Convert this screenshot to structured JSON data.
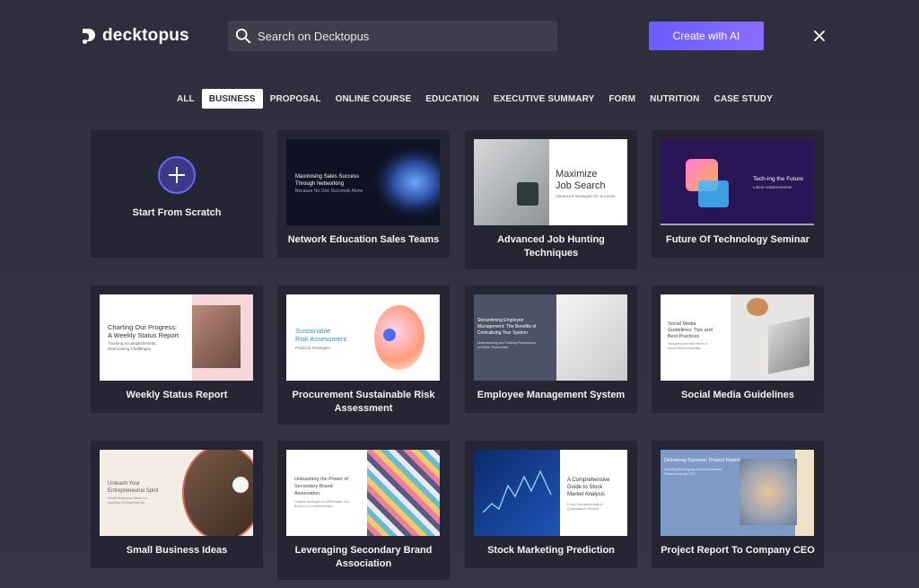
{
  "header": {
    "logo_text": "decktopus",
    "search_placeholder": "Search on Decktopus",
    "ai_button": "Create with AI"
  },
  "tabs": [
    "ALL",
    "BUSINESS",
    "PROPOSAL",
    "ONLINE COURSE",
    "EDUCATION",
    "EXECUTIVE SUMMARY",
    "FORM",
    "NUTRITION",
    "CASE STUDY"
  ],
  "active_tab": "BUSINESS",
  "cards": [
    {
      "title": "Start From Scratch"
    },
    {
      "title": "Network Education Sales Teams",
      "thumb_lines": [
        "Maximising Sales Success",
        "Through Networking",
        "Because No One Succeeds Alone"
      ]
    },
    {
      "title": "Advanced Job Hunting Techniques",
      "thumb_lines": [
        "Maximize",
        "Job Search",
        "Advanced Strategies for Success"
      ]
    },
    {
      "title": "Future Of Technology Seminar",
      "thumb_lines": [
        "Tech-ing the Future",
        "Latest Advancements"
      ]
    },
    {
      "title": "Weekly Status Report",
      "thumb_lines": [
        "Charting Our Progress:",
        "A Weekly Status Report",
        "Tracking Accomplishments,",
        "Overcoming Challenges"
      ]
    },
    {
      "title": "Procurement Sustainable Risk Assessment",
      "thumb_lines": [
        "Sustainable",
        "Risk Assessment",
        "Practical Strategies"
      ]
    },
    {
      "title": "Employee Management System",
      "thumb_lines": [
        "Streamlining Employee",
        "Management: The Benefits of",
        "Centralizing Your System",
        "Understanding and Tracking Performance",
        "for Better Team Action"
      ]
    },
    {
      "title": "Social Media Guidelines",
      "thumb_lines": [
        "Social Media",
        "Guidelines: Tips and",
        "Best Practices",
        "Navigating the Wild World of",
        "Social Media Marketing"
      ]
    },
    {
      "title": "Small Business Ideas",
      "thumb_lines": [
        "Unleash Your",
        "Entrepreneurial Spirit",
        "Small Business Ideas for",
        "Aspiring Entrepreneurs"
      ]
    },
    {
      "title": "Leveraging Secondary Brand Association",
      "thumb_lines": [
        "Unleashing the Power of",
        "Secondary Brand",
        "Association",
        "Creative Strategies to Differentiate Your",
        "Brand in a Crowded Market"
      ]
    },
    {
      "title": "Stock Marketing Prediction",
      "thumb_lines": [
        "A Comprehensive",
        "Guide to Stock",
        "Market Analysis",
        "From Fundamentals to",
        "Quantitative Models"
      ]
    },
    {
      "title": "Project Report To Company CEO",
      "thumb_lines": [
        "Delivering Success: Project Report",
        "Unveiling the progress and achievements",
        "Presented by the CEO"
      ]
    }
  ],
  "colors": {
    "accent": "#6c63ff",
    "card_bg": "#262533",
    "page_bg": "#32313f"
  }
}
